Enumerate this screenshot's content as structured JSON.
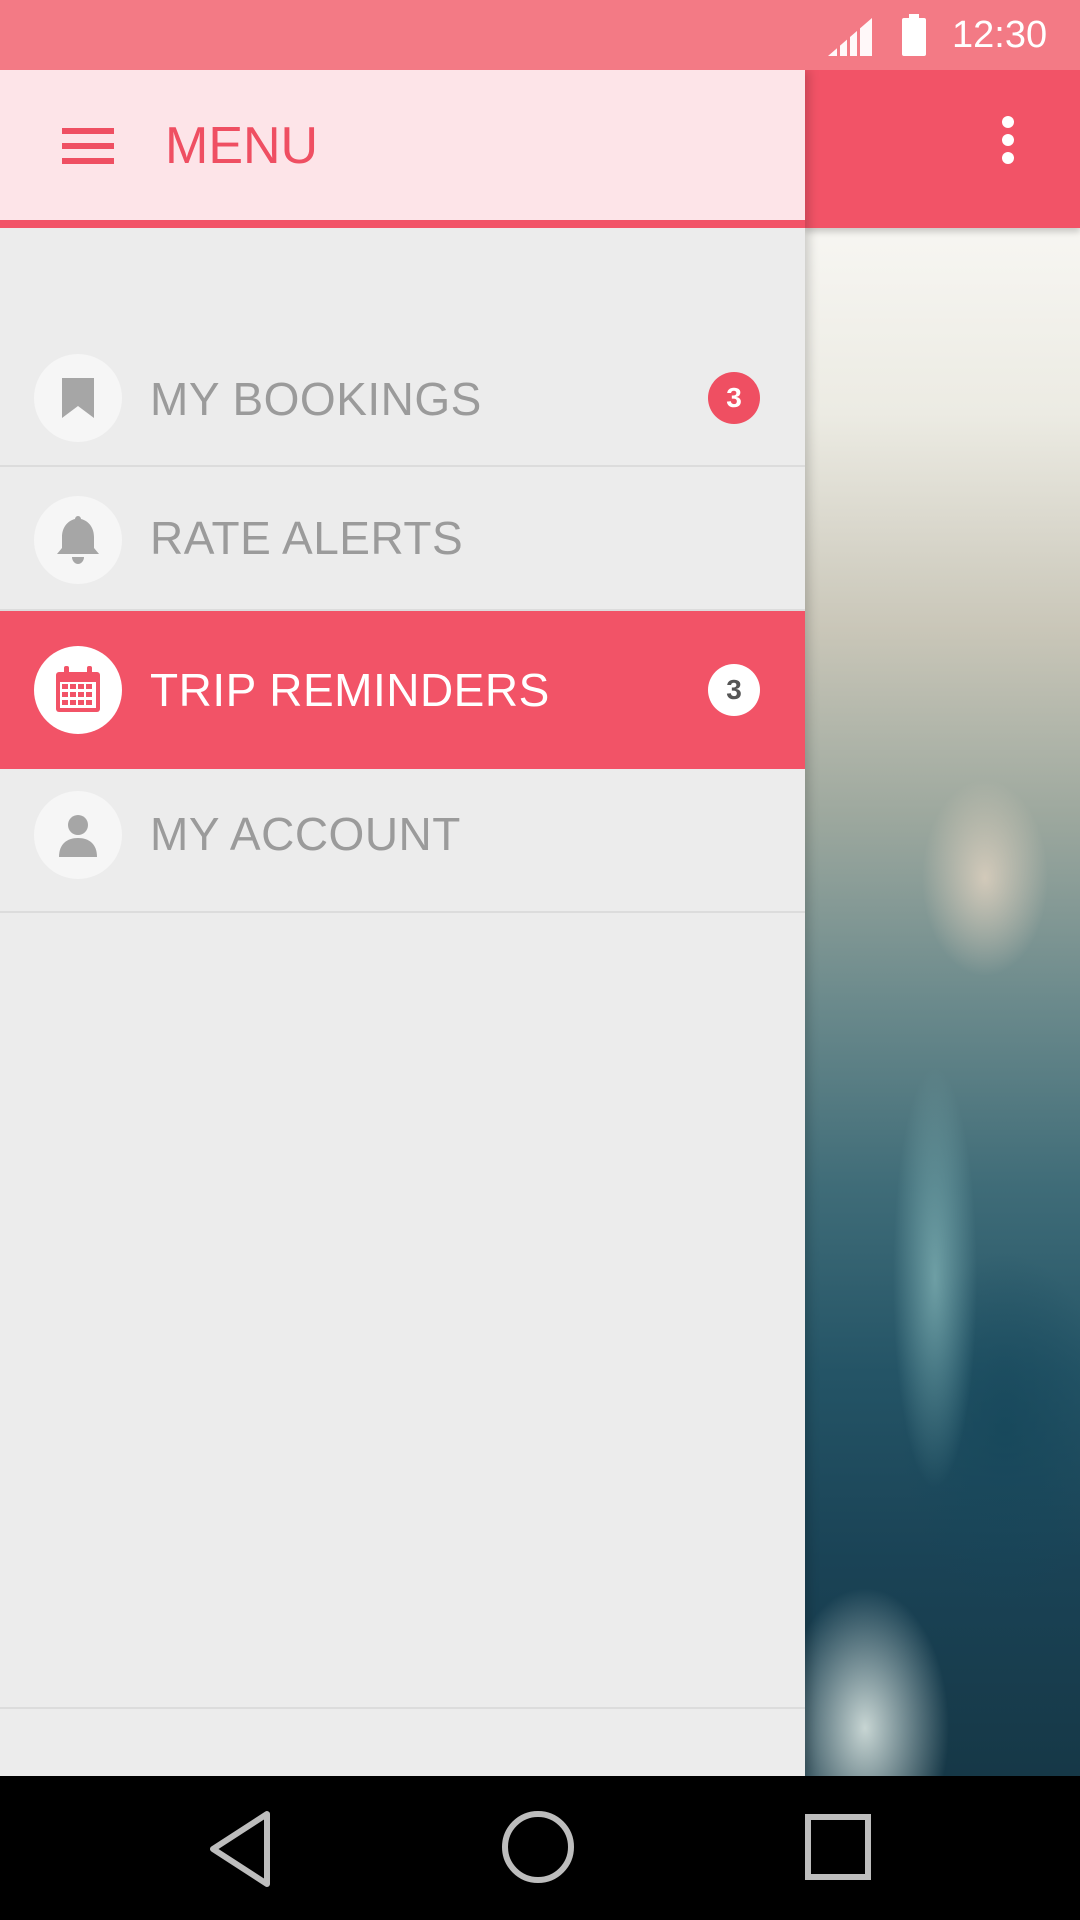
{
  "status_bar": {
    "time": "12:30",
    "signal_icon": "signal-icon",
    "battery_icon": "battery-icon"
  },
  "drawer": {
    "title": "MENU",
    "menu_icon": "hamburger-menu-icon",
    "items": [
      {
        "label": "MY BOOKINGS",
        "icon": "bookmark-icon",
        "badge": "3",
        "active": false
      },
      {
        "label": "RATE ALERTS",
        "icon": "bell-icon",
        "active": false
      },
      {
        "label": "TRIP REMINDERS",
        "icon": "calendar-icon",
        "badge": "3",
        "active": true
      },
      {
        "label": "MY ACCOUNT",
        "icon": "person-icon",
        "active": false
      }
    ]
  },
  "app_bar": {
    "overflow_icon": "more-vert-icon"
  },
  "nav_bar": {
    "back_icon": "back-icon",
    "home_icon": "home-icon",
    "recents_icon": "recents-icon"
  },
  "colors": {
    "accent": "#f25367",
    "status_bar": "#f37a85",
    "drawer_header": "#fde4e8",
    "drawer_bg": "#ececec",
    "inactive_text": "#9b9b9b"
  }
}
